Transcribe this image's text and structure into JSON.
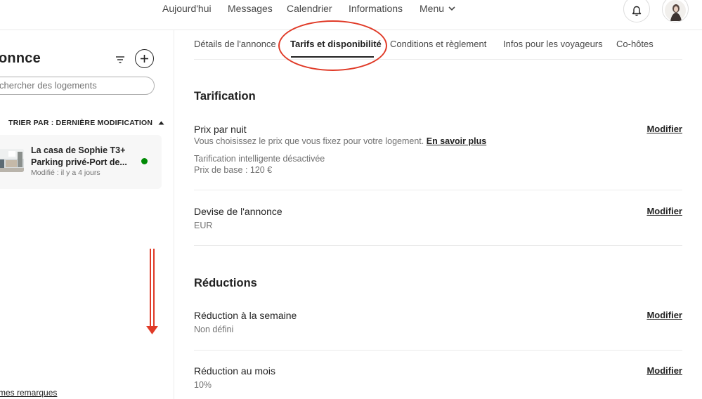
{
  "topnav": {
    "links": [
      "Aujourd'hui",
      "Messages",
      "Calendrier",
      "Informations"
    ],
    "menu_label": "Menu"
  },
  "sidebar": {
    "title": "onnce",
    "search_placeholder": "chercher des logements",
    "sort_label": "TRIER PAR : DERNIÈRE MODIFICATION",
    "listing": {
      "name_line1": "La casa de Sophie T3+",
      "name_line2": "Parking privé-Port de...",
      "modified": "Modifié : il y a 4 jours",
      "status_color": "#008a05"
    },
    "feedback_link": "mes remarques"
  },
  "main": {
    "tabs": [
      "Détails de l'annonce",
      "Tarifs et disponibilité",
      "Conditions et règlement",
      "Infos pour les voyageurs",
      "Co-hôtes"
    ],
    "active_tab": "Tarifs et disponibilité",
    "pricing": {
      "title": "Tarification",
      "nightly": {
        "label": "Prix par nuit",
        "description": "Vous choisissez le prix que vous fixez pour votre logement.",
        "learn_more": "En savoir plus",
        "smart_pricing": "Tarification intelligente désactivée",
        "base_price": "Prix de base : 120 €"
      },
      "currency": {
        "label": "Devise de l'annonce",
        "value": "EUR"
      }
    },
    "discounts": {
      "title": "Réductions",
      "weekly": {
        "label": "Réduction à la semaine",
        "value": "Non défini"
      },
      "monthly": {
        "label": "Réduction au mois",
        "value": "10%"
      }
    },
    "modify_label": "Modifier"
  },
  "annotations": {
    "highlight_color": "#e03a27"
  }
}
